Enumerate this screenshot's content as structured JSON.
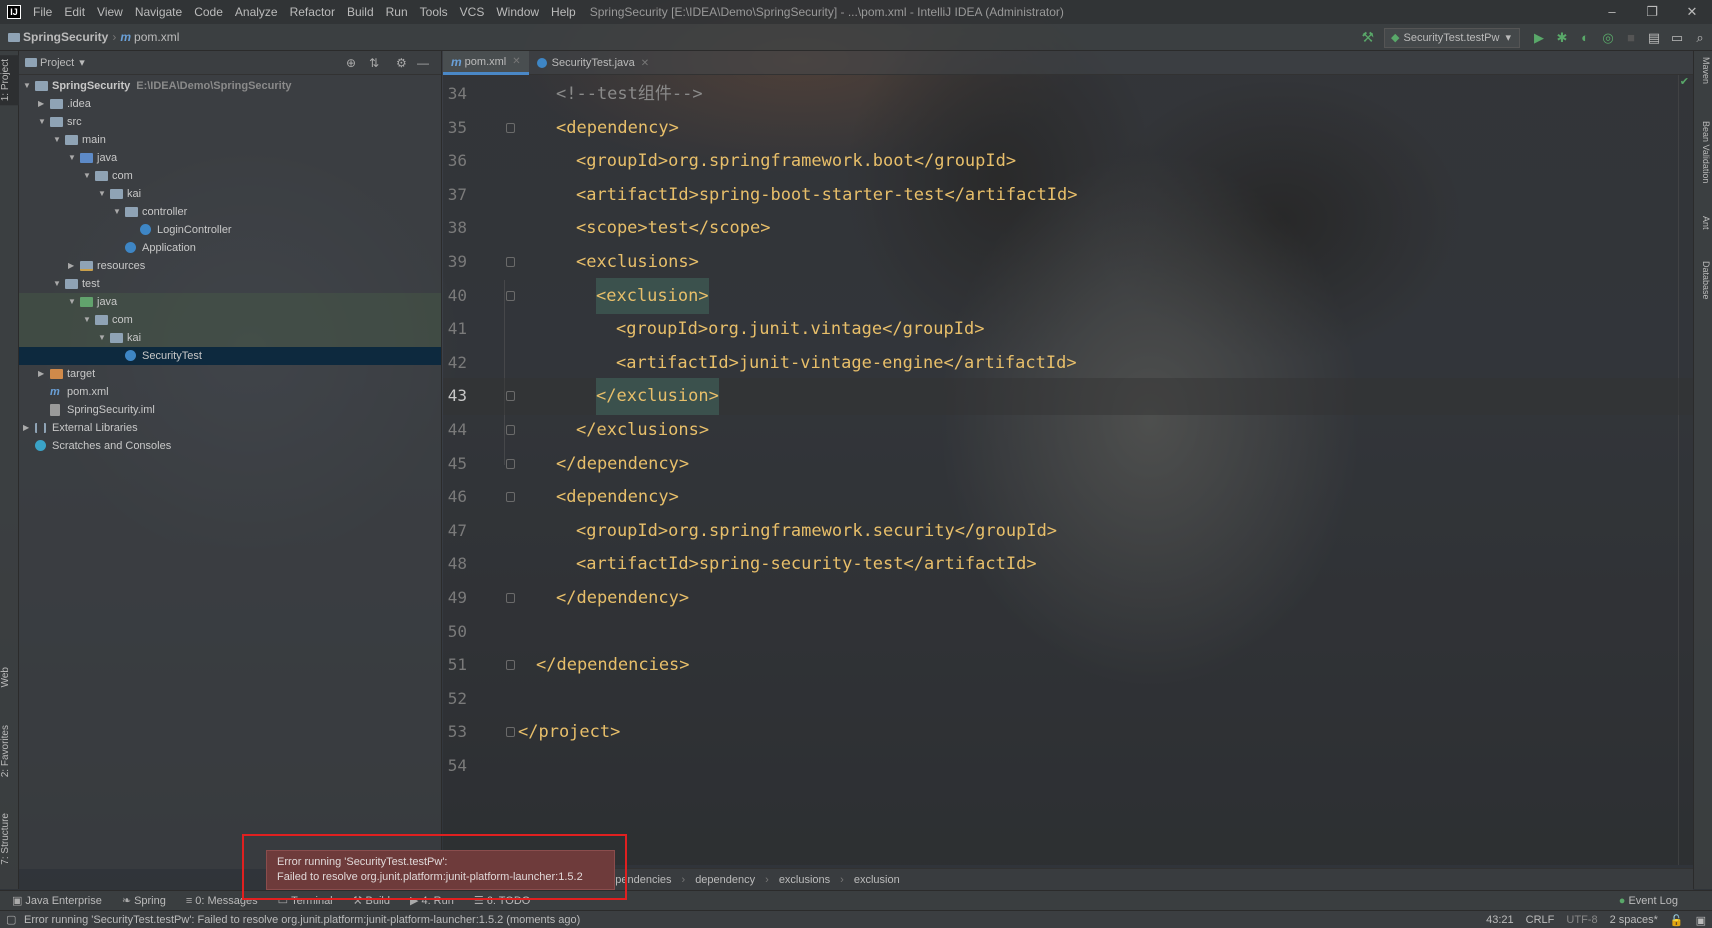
{
  "window": {
    "app_logo": "IJ",
    "title": "SpringSecurity [E:\\IDEA\\Demo\\SpringSecurity] - ...\\pom.xml - IntelliJ IDEA (Administrator)",
    "minimize": "–",
    "restore": "❐",
    "close": "✕"
  },
  "menu": [
    "File",
    "Edit",
    "View",
    "Navigate",
    "Code",
    "Analyze",
    "Refactor",
    "Build",
    "Run",
    "Tools",
    "VCS",
    "Window",
    "Help"
  ],
  "navbar": {
    "project": "SpringSecurity",
    "file_icon": "m",
    "file": "pom.xml",
    "run_config": "SecurityTest.testPw",
    "icons": [
      "hammer-icon",
      "run-icon",
      "debug-icon",
      "coverage-icon",
      "profile-icon",
      "stop-icon",
      "project-structure-icon",
      "layout-icon",
      "search-icon"
    ]
  },
  "left_strip": {
    "tabs": [
      "1: Project",
      "Web",
      "2: Favorites",
      "7: Structure"
    ]
  },
  "project_panel": {
    "header": "Project",
    "tree": [
      {
        "label": "SpringSecurity",
        "path": "E:\\IDEA\\Demo\\SpringSecurity",
        "icon": "dir",
        "arrow": "▼",
        "bold": true
      },
      {
        "label": ".idea",
        "icon": "dir",
        "arrow": "▶"
      },
      {
        "label": "src",
        "icon": "dir",
        "arrow": "▼"
      },
      {
        "label": "main",
        "icon": "dir",
        "arrow": "▼"
      },
      {
        "label": "java",
        "icon": "src",
        "arrow": "▼"
      },
      {
        "label": "com",
        "icon": "dir",
        "arrow": "▼"
      },
      {
        "label": "kai",
        "icon": "dir",
        "arrow": "▼"
      },
      {
        "label": "controller",
        "icon": "dir",
        "arrow": "▼"
      },
      {
        "label": "LoginController",
        "icon": "cls",
        "arrow": ""
      },
      {
        "label": "Application",
        "icon": "cls",
        "arrow": ""
      },
      {
        "label": "resources",
        "icon": "res",
        "arrow": "▶"
      },
      {
        "label": "test",
        "icon": "dir",
        "arrow": "▼"
      },
      {
        "label": "java",
        "icon": "tst",
        "arrow": "▼"
      },
      {
        "label": "com",
        "icon": "dir",
        "arrow": "▼"
      },
      {
        "label": "kai",
        "icon": "dir",
        "arrow": "▼"
      },
      {
        "label": "SecurityTest",
        "icon": "cls",
        "arrow": ""
      },
      {
        "label": "target",
        "icon": "tgt",
        "arrow": "▶"
      },
      {
        "label": "pom.xml",
        "icon": "xml",
        "arrow": ""
      },
      {
        "label": "SpringSecurity.iml",
        "icon": "iml",
        "arrow": ""
      },
      {
        "label": "External Libraries",
        "icon": "lib",
        "arrow": "▶"
      },
      {
        "label": "Scratches and Consoles",
        "icon": "scr",
        "arrow": ""
      }
    ]
  },
  "editor_tabs": [
    {
      "label": "pom.xml",
      "icon": "m",
      "active": true
    },
    {
      "label": "SecurityTest.java",
      "icon": "java",
      "active": false
    }
  ],
  "editor": {
    "current_line": 43,
    "lines": [
      {
        "n": "34",
        "text": "<!--test组件-->"
      },
      {
        "n": "35",
        "text": "<dependency>"
      },
      {
        "n": "36",
        "text": "<groupId>org.springframework.boot</groupId>"
      },
      {
        "n": "37",
        "text": "<artifactId>spring-boot-starter-test</artifactId>"
      },
      {
        "n": "38",
        "text": "<scope>test</scope>"
      },
      {
        "n": "39",
        "text": "<exclusions>"
      },
      {
        "n": "40",
        "text": "<exclusion>"
      },
      {
        "n": "41",
        "text": "<groupId>org.junit.vintage</groupId>"
      },
      {
        "n": "42",
        "text": "<artifactId>junit-vintage-engine</artifactId>"
      },
      {
        "n": "43",
        "text": "</exclusion>"
      },
      {
        "n": "44",
        "text": "</exclusions>"
      },
      {
        "n": "45",
        "text": "</dependency>"
      },
      {
        "n": "46",
        "text": "<dependency>"
      },
      {
        "n": "47",
        "text": "<groupId>org.springframework.security</groupId>"
      },
      {
        "n": "48",
        "text": "<artifactId>spring-security-test</artifactId>"
      },
      {
        "n": "49",
        "text": "</dependency>"
      },
      {
        "n": "50",
        "text": ""
      },
      {
        "n": "51",
        "text": "</dependencies>"
      },
      {
        "n": "52",
        "text": ""
      },
      {
        "n": "53",
        "text": "</project>"
      },
      {
        "n": "54",
        "text": ""
      }
    ]
  },
  "breadcrumbs": [
    "dependencies",
    "dependency",
    "exclusions",
    "exclusion"
  ],
  "right_strip": {
    "tabs": [
      "Maven",
      "Bean Validation",
      "Ant",
      "Database"
    ]
  },
  "bottom_tools": [
    {
      "label": "Java Enterprise",
      "icon": "▣"
    },
    {
      "label": "Spring",
      "icon": "❧"
    },
    {
      "label": "0: Messages",
      "icon": "≡"
    },
    {
      "label": "Terminal",
      "icon": "▭"
    },
    {
      "label": "Build",
      "icon": "⚒"
    },
    {
      "label": "4: Run",
      "icon": "▶"
    },
    {
      "label": "6: TODO",
      "icon": "☰"
    }
  ],
  "event_log": "Event Log",
  "status": {
    "message": "Error running 'SecurityTest.testPw': Failed to resolve org.junit.platform:junit-platform-launcher:1.5.2 (moments ago)",
    "position": "43:21",
    "line_sep": "CRLF",
    "encoding": "UTF-8",
    "indent": "2 spaces*"
  },
  "error_popup": {
    "line1": "Error running 'SecurityTest.testPw':",
    "line2": "Failed to resolve org.junit.platform:junit-platform-launcher:1.5.2"
  }
}
